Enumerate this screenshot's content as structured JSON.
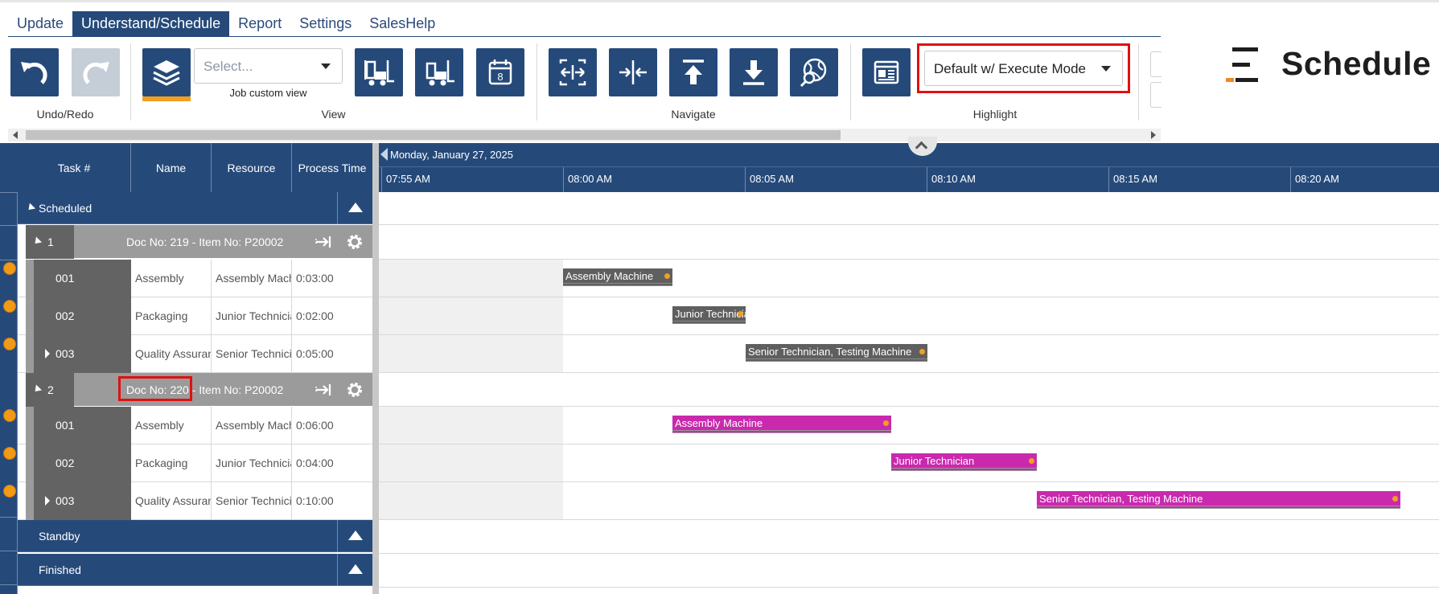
{
  "tabs": [
    "Update",
    "Understand/Schedule",
    "Report",
    "Settings",
    "SalesHelp"
  ],
  "ribbon": {
    "groups": {
      "undo_redo": "Undo/Redo",
      "view": "View",
      "navigate": "Navigate",
      "highlight": "Highlight"
    },
    "view_select_placeholder": "Select...",
    "job_custom_view": "Job custom view",
    "highlight_value": "Default w/ Execute Mode",
    "calendar_day": "8"
  },
  "logo": {
    "text": "Schedule"
  },
  "grid": {
    "columns": [
      "Task #",
      "Name",
      "Resource",
      "Process Time"
    ],
    "sections": {
      "scheduled": "Scheduled",
      "standby": "Standby",
      "finished": "Finished"
    },
    "jobs": [
      {
        "number": "1",
        "title": "Doc No: 219 - Item No: P20002",
        "tasks": [
          {
            "id": "001",
            "name": "Assembly",
            "resource": "Assembly Machine",
            "time": "0:03:00"
          },
          {
            "id": "002",
            "name": "Packaging",
            "resource": "Junior Technician",
            "time": "0:02:00"
          },
          {
            "id": "003",
            "name": "Quality Assurance",
            "resource": "Senior Technician",
            "time": "0:05:00"
          }
        ]
      },
      {
        "number": "2",
        "title": "Doc No: 220 - Item No: P20002",
        "tasks": [
          {
            "id": "001",
            "name": "Assembly",
            "resource": "Assembly Machine",
            "time": "0:06:00"
          },
          {
            "id": "002",
            "name": "Packaging",
            "resource": "Junior Technician",
            "time": "0:04:00"
          },
          {
            "id": "003",
            "name": "Quality Assurance",
            "resource": "Senior Technician",
            "time": "0:10:00"
          }
        ]
      }
    ]
  },
  "timeline": {
    "date": "Monday, January 27, 2025",
    "ticks": [
      "07:55 AM",
      "08:00 AM",
      "08:05 AM",
      "08:10 AM",
      "08:15 AM",
      "08:20 AM"
    ],
    "bars": {
      "j1t1": "Assembly Machine",
      "j1t2": "Junior Technician",
      "j1t3": "Senior Technician, Testing Machine",
      "j2t1": "Assembly Machine",
      "j2t2": "Junior Technician",
      "j2t3": "Senior Technician, Testing Machine"
    }
  },
  "colors": {
    "navy": "#254a7a",
    "job1_bar": "#5f5f5f",
    "job2_bar": "#c92aad",
    "accent_orange": "#f0a020",
    "highlight_red": "#e01010"
  }
}
